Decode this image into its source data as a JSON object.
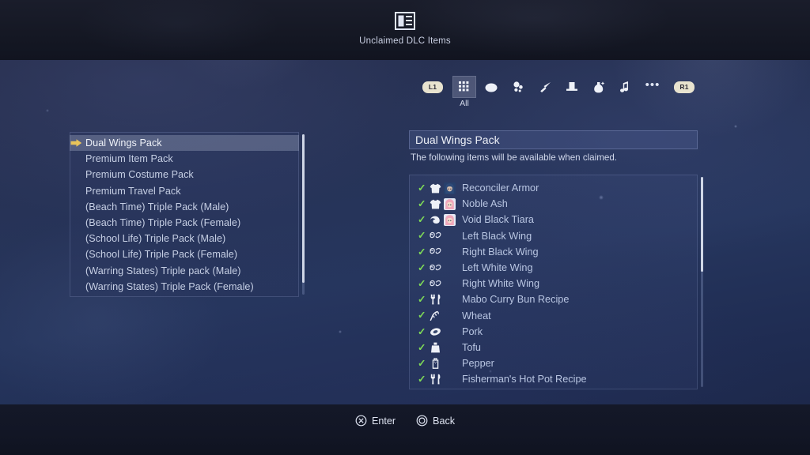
{
  "header": {
    "icon": "dlc-box-icon",
    "title": "Unclaimed DLC Items"
  },
  "toolbar": {
    "left_bumper": "L1",
    "right_bumper": "R1",
    "selected_label": "All",
    "categories": [
      {
        "icon": "grid-all-icon",
        "label": "All",
        "selected": true
      },
      {
        "icon": "egg-icon",
        "label": "",
        "selected": false
      },
      {
        "icon": "paw-icon",
        "label": "",
        "selected": false
      },
      {
        "icon": "sword-icon",
        "label": "",
        "selected": false
      },
      {
        "icon": "top-hat-icon",
        "label": "",
        "selected": false
      },
      {
        "icon": "potion-icon",
        "label": "",
        "selected": false
      },
      {
        "icon": "music-note-icon",
        "label": "",
        "selected": false
      },
      {
        "icon": "ellipsis-icon",
        "label": "",
        "selected": false
      }
    ]
  },
  "pack_list": {
    "cursor_icon": "arrow-cursor-icon",
    "items": [
      {
        "label": "Dual Wings Pack",
        "selected": true
      },
      {
        "label": "Premium Item Pack",
        "selected": false
      },
      {
        "label": "Premium Costume Pack",
        "selected": false
      },
      {
        "label": "Premium Travel Pack",
        "selected": false
      },
      {
        "label": "(Beach Time) Triple Pack (Male)",
        "selected": false
      },
      {
        "label": "(Beach Time) Triple Pack (Female)",
        "selected": false
      },
      {
        "label": "(School Life) Triple Pack (Male)",
        "selected": false
      },
      {
        "label": "(School Life) Triple Pack (Female)",
        "selected": false
      },
      {
        "label": "(Warring States) Triple pack (Male)",
        "selected": false
      },
      {
        "label": "(Warring States) Triple Pack (Female)",
        "selected": false
      }
    ]
  },
  "detail": {
    "title": "Dual Wings Pack",
    "description": "The following items will be available when claimed.",
    "items": [
      {
        "label": "Reconciler Armor",
        "check": "✓",
        "icon": "shirt-icon",
        "portrait": "character-blue"
      },
      {
        "label": "Noble Ash",
        "check": "✓",
        "icon": "shirt-icon",
        "portrait": "character-pink"
      },
      {
        "label": "Void Black Tiara",
        "check": "✓",
        "icon": "tiara-icon",
        "portrait": "character-pink"
      },
      {
        "label": "Left Black Wing",
        "check": "✓",
        "icon": "wing-icon",
        "portrait": ""
      },
      {
        "label": "Right Black Wing",
        "check": "✓",
        "icon": "wing-icon",
        "portrait": ""
      },
      {
        "label": "Left White Wing",
        "check": "✓",
        "icon": "wing-icon",
        "portrait": ""
      },
      {
        "label": "Right White Wing",
        "check": "✓",
        "icon": "wing-icon",
        "portrait": ""
      },
      {
        "label": "Mabo Curry Bun Recipe",
        "check": "✓",
        "icon": "cutlery-icon",
        "portrait": ""
      },
      {
        "label": "Wheat",
        "check": "✓",
        "icon": "wheat-icon",
        "portrait": ""
      },
      {
        "label": "Pork",
        "check": "✓",
        "icon": "meat-icon",
        "portrait": ""
      },
      {
        "label": "Tofu",
        "check": "✓",
        "icon": "tofu-icon",
        "portrait": ""
      },
      {
        "label": "Pepper",
        "check": "✓",
        "icon": "pepper-icon",
        "portrait": ""
      },
      {
        "label": "Fisherman's Hot Pot Recipe",
        "check": "✓",
        "icon": "cutlery-icon",
        "portrait": ""
      }
    ]
  },
  "footer": {
    "buttons": [
      {
        "glyph": "cross-button-icon",
        "label": "Enter"
      },
      {
        "glyph": "circle-button-icon",
        "label": "Back"
      }
    ]
  },
  "colors": {
    "check_green": "#7ed957",
    "bumper_cream": "#e8e3cf",
    "cursor_gold": "#e8c45a",
    "text_primary": "#eef1f8",
    "text_muted": "#b9c6e2"
  }
}
